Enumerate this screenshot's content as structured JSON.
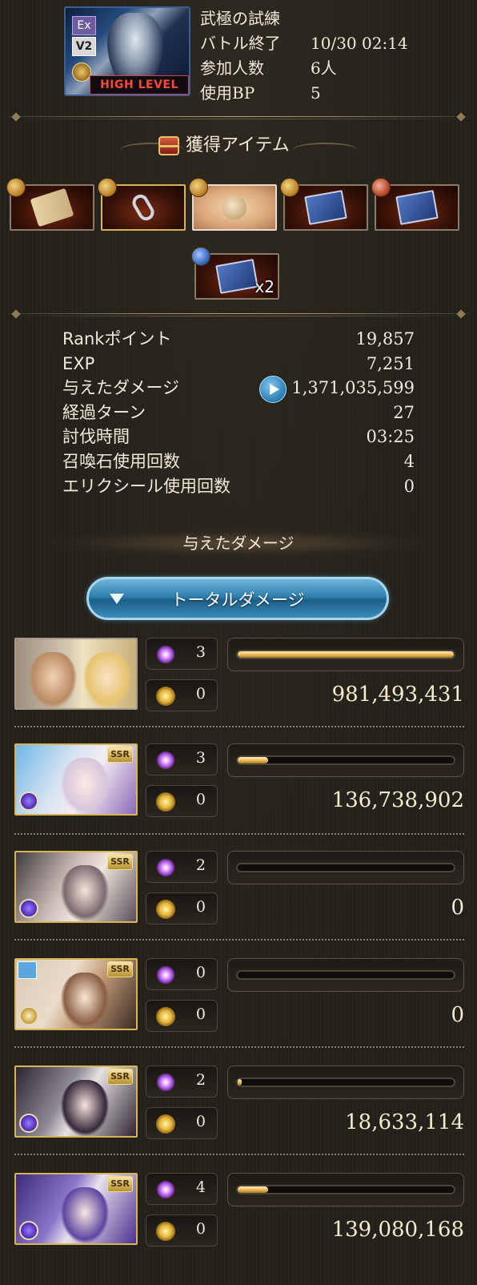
{
  "quest": {
    "badge_ex": "Ex",
    "badge_v2": "V2",
    "high_level": "HIGH LEVEL",
    "name": "武極の試練",
    "battle_end_label": "バトル終了",
    "battle_end_value": "10/30 02:14",
    "participants_label": "参加人数",
    "participants_value": "6人",
    "bp_label": "使用BP",
    "bp_value": "5"
  },
  "items_heading": "獲得アイテム",
  "items": [
    {
      "name": "scroll",
      "qty": ""
    },
    {
      "name": "ring",
      "qty": ""
    },
    {
      "name": "pouch",
      "qty": ""
    },
    {
      "name": "book",
      "qty": ""
    },
    {
      "name": "book",
      "qty": ""
    },
    {
      "name": "book",
      "qty": "x2"
    }
  ],
  "stats": [
    {
      "label": "Rankポイント",
      "value": "19,857"
    },
    {
      "label": "EXP",
      "value": "7,251"
    },
    {
      "label": "与えたダメージ",
      "value": "1,371,035,599"
    },
    {
      "label": "経過ターン",
      "value": "27"
    },
    {
      "label": "討伐時間",
      "value": "03:25"
    },
    {
      "label": "召喚石使用回数",
      "value": "4"
    },
    {
      "label": "エリクシール使用回数",
      "value": "0"
    }
  ],
  "damage_heading": "与えたダメージ",
  "total_button": "トータルダメージ",
  "players": [
    {
      "star_count": "3",
      "cross_count": "0",
      "damage": "981,493,431",
      "ratio": 1.0
    },
    {
      "star_count": "3",
      "cross_count": "0",
      "damage": "136,738,902",
      "ratio": 0.139
    },
    {
      "star_count": "2",
      "cross_count": "0",
      "damage": "0",
      "ratio": 0
    },
    {
      "star_count": "0",
      "cross_count": "0",
      "damage": "0",
      "ratio": 0
    },
    {
      "star_count": "2",
      "cross_count": "0",
      "damage": "18,633,114",
      "ratio": 0.019
    },
    {
      "star_count": "4",
      "cross_count": "0",
      "damage": "139,080,168",
      "ratio": 0.142
    }
  ],
  "colors": {
    "background": "#24211b",
    "bar_fill": "#e8b04a",
    "button_blue": "#2f7fae",
    "ssr_gold": "#d9b454"
  }
}
